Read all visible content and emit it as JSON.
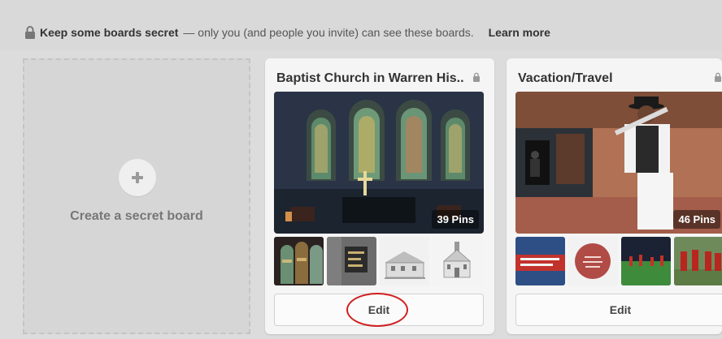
{
  "banner": {
    "title": "Keep some boards secret",
    "description": "— only you (and people you invite) can see these boards.",
    "learn_more": "Learn more",
    "icon": "lock-icon"
  },
  "create_board": {
    "label": "Create a secret board",
    "icon": "plus-icon"
  },
  "boards": [
    {
      "title": "Baptist Church in Warren His..",
      "pin_count": "39 Pins",
      "edit_label": "Edit",
      "icon": "lock-icon",
      "highlight_color": "#d02020"
    },
    {
      "title": "Vacation/Travel",
      "pin_count": "46 Pins",
      "edit_label": "Edit",
      "icon": "lock-icon"
    }
  ],
  "colors": {
    "background": "#dcdcdc",
    "card": "#f5f5f5",
    "highlight": "#d02020"
  }
}
